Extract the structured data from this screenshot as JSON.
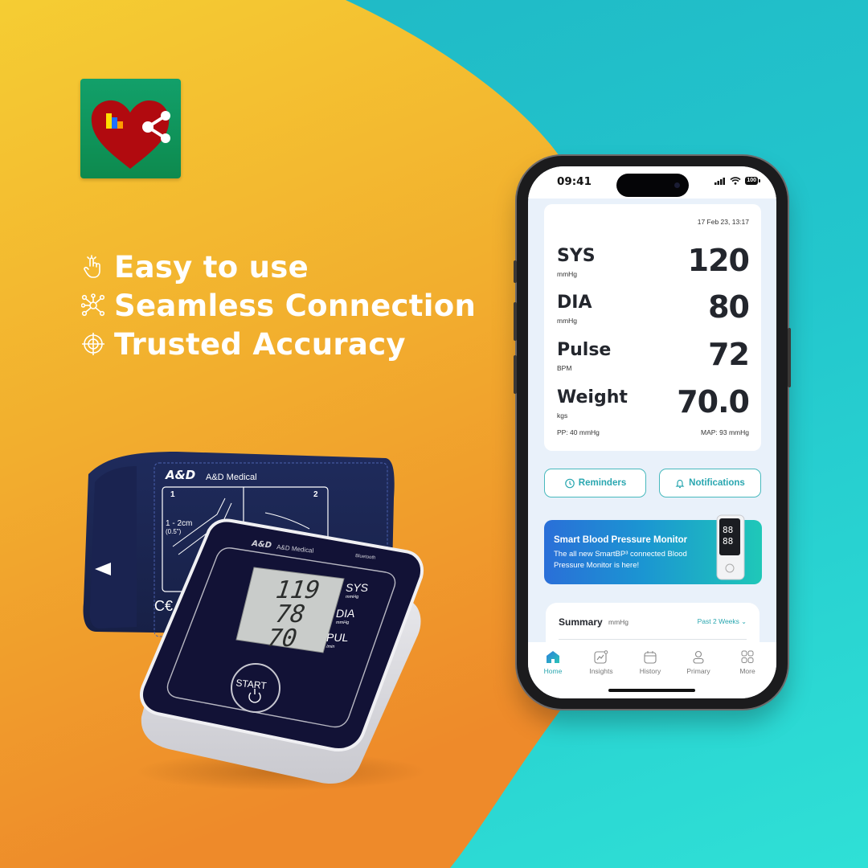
{
  "colors": {
    "bg_orange_top": "#f4c832",
    "bg_orange_bottom": "#ef8f2a",
    "bg_teal": "#23c7cd",
    "app_icon_green": "#0f9a5e",
    "heart_red": "#b30b10",
    "accent_teal": "#2aa7b0",
    "device_navy": "#12123a",
    "cuff_navy": "#1c2550",
    "text_dark": "#23262d"
  },
  "app_icon": {
    "name": "heart-share-icon"
  },
  "features": [
    {
      "icon": "tap-hand-icon",
      "label": "Easy to use"
    },
    {
      "icon": "network-icon",
      "label": "Seamless Connection"
    },
    {
      "icon": "target-icon",
      "label": "Trusted Accuracy"
    }
  ],
  "device": {
    "brand": "A&D Medical",
    "brand_logo": "A&D",
    "bluetooth_label": "Bluetooth",
    "cuff_steps": [
      "1",
      "2"
    ],
    "cuff_measure": "1 - 2cm",
    "cuff_measure_inch": "(0.5\")",
    "display": [
      {
        "value": "119",
        "label": "SYS",
        "unit": "mmHg"
      },
      {
        "value": "78",
        "label": "DIA",
        "unit": "mmHg"
      },
      {
        "value": "70",
        "label": "PUL",
        "unit": "/min"
      }
    ],
    "start_label": "START"
  },
  "phone": {
    "status": {
      "time": "09:41",
      "battery": "100"
    },
    "reading": {
      "date": "17 Feb 23, 13:17",
      "metrics": [
        {
          "label": "SYS",
          "unit": "mmHg",
          "value": "120"
        },
        {
          "label": "DIA",
          "unit": "mmHg",
          "value": "80"
        },
        {
          "label": "Pulse",
          "unit": "BPM",
          "value": "72"
        },
        {
          "label": "Weight",
          "unit": "kgs",
          "value": "70.0"
        }
      ],
      "pp": "PP: 40 mmHg",
      "map": "MAP: 93 mmHg"
    },
    "buttons": {
      "reminders": "Reminders",
      "notifications": "Notifications"
    },
    "promo": {
      "title": "Smart Blood Pressure Monitor",
      "subtitle": "The all new SmartBP³ connected Blood Pressure Monitor is here!"
    },
    "summary": {
      "title": "Summary",
      "unit": "mmHg",
      "range": "Past 2 Weeks"
    },
    "tabs": [
      {
        "label": "Home",
        "icon": "home-icon",
        "active": true
      },
      {
        "label": "Insights",
        "icon": "insights-icon",
        "active": false
      },
      {
        "label": "History",
        "icon": "calendar-icon",
        "active": false
      },
      {
        "label": "Primary",
        "icon": "user-icon",
        "active": false
      },
      {
        "label": "More",
        "icon": "grid-icon",
        "active": false
      }
    ]
  }
}
